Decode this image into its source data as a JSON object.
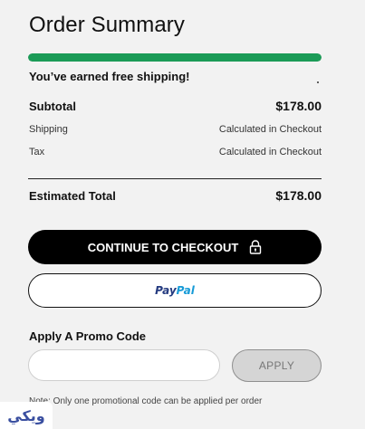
{
  "summary": {
    "title": "Order Summary",
    "free_shipping_progress": 1.0,
    "free_shipping_message": "You’ve earned free shipping!",
    "subtotal_label": "Subtotal",
    "subtotal_value": "$178.00",
    "shipping_label": "Shipping",
    "shipping_value": "Calculated in Checkout",
    "tax_label": "Tax",
    "tax_value": "Calculated in Checkout",
    "total_label": "Estimated Total",
    "total_value": "$178.00"
  },
  "actions": {
    "checkout_label": "CONTINUE TO CHECKOUT",
    "paypal_part1": "Pay",
    "paypal_part2": "Pal"
  },
  "promo": {
    "label": "Apply A Promo Code",
    "input_value": "",
    "input_placeholder": "",
    "apply_label": "APPLY",
    "note": "Note: Only one promotional code can be applied per order"
  },
  "watermark": {
    "text": "ويكي"
  },
  "colors": {
    "progress": "#1b9b57",
    "checkout_bg": "#000000",
    "paypal_dark": "#253b80",
    "paypal_light": "#179bd7",
    "apply_bg": "#d5d5d5"
  }
}
